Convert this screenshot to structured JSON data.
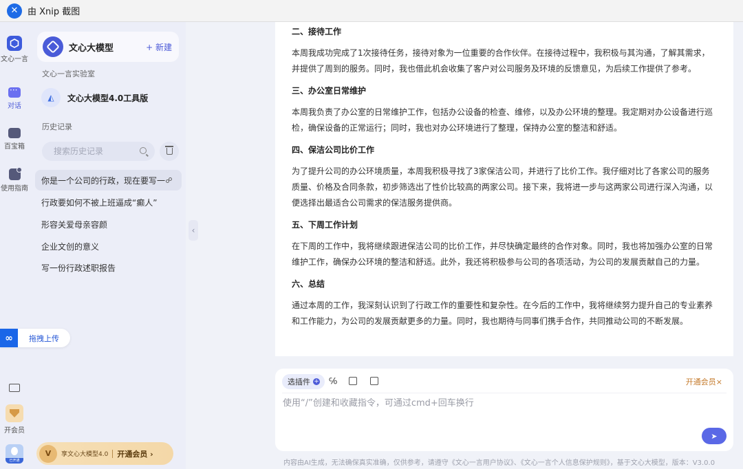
{
  "window": {
    "title": "由 Xnip 截图"
  },
  "rail": {
    "items": [
      {
        "label": "文心一言"
      },
      {
        "label": "对话"
      },
      {
        "label": "百宝箱"
      },
      {
        "label": "使用指南"
      }
    ],
    "upload_label": "拖拽上传",
    "vip_label": "开会员",
    "avatar_tag": "已开通"
  },
  "sidebar": {
    "model_name": "文心大模型",
    "new_label": "+ 新建",
    "lab_title": "文心一言实验室",
    "tool_name": "文心大模型4.0工具版",
    "history_title": "历史记录",
    "search_placeholder": "搜索历史记录",
    "history": [
      "你是一个公司的行政，现在要写一",
      "行政要如何不被上班逼成“癫人”",
      "形容关爱母亲容颜",
      "企业文创的意义",
      "写一份行政述职报告"
    ],
    "promo_text": "享文心大模型4.0",
    "promo_button": "开通会员 ›"
  },
  "document": {
    "sections": [
      {
        "heading": "二、接待工作",
        "body": "本周我成功完成了1次接待任务，接待对象为一位重要的合作伙伴。在接待过程中，我积极与其沟通，了解其需求，并提供了周到的服务。同时，我也借此机会收集了客户对公司服务及环境的反馈意见，为后续工作提供了参考。"
      },
      {
        "heading": "三、办公室日常维护",
        "body": "本周我负责了办公室的日常维护工作，包括办公设备的检查、维修，以及办公环境的整理。我定期对办公设备进行巡检，确保设备的正常运行；同时，我也对办公环境进行了整理，保持办公室的整洁和舒适。"
      },
      {
        "heading": "四、保洁公司比价工作",
        "body": "为了提升公司的办公环境质量，本周我积极寻找了3家保洁公司，并进行了比价工作。我仔细对比了各家公司的服务质量、价格及合同条款，初步筛选出了性价比较高的两家公司。接下来，我将进一步与这两家公司进行深入沟通，以便选择出最适合公司需求的保洁服务提供商。"
      },
      {
        "heading": "五、下周工作计划",
        "body": "在下周的工作中，我将继续跟进保洁公司的比价工作，并尽快确定最终的合作对象。同时，我也将加强办公室的日常维护工作，确保办公环境的整洁和舒适。此外，我还将积极参与公司的各项活动，为公司的发展贡献自己的力量。"
      },
      {
        "heading": "六、总结",
        "body": "通过本周的工作，我深刻认识到了行政工作的重要性和复杂性。在今后的工作中，我将继续努力提升自己的专业素养和工作能力，为公司的发展贡献更多的力量。同时，我也期待与同事们携手合作，共同推动公司的不断发展。"
      }
    ]
  },
  "composer": {
    "plugin_label": "选插件",
    "plus_icon": "+",
    "vip_link": "开通会员×",
    "placeholder": "使用“/”创建和收藏指令，可通过cmd+回车换行"
  },
  "footer": {
    "note": "内容由AI生成，无法确保真实准确，仅供参考，请遵守《文心一言用户协议》、《文心一言个人信息保护规则》，基于文心大模型，版本：V3.0.0"
  },
  "colors": {
    "accent": "#4d5bd8",
    "vip": "#c4792a",
    "send": "#5a68e6"
  }
}
